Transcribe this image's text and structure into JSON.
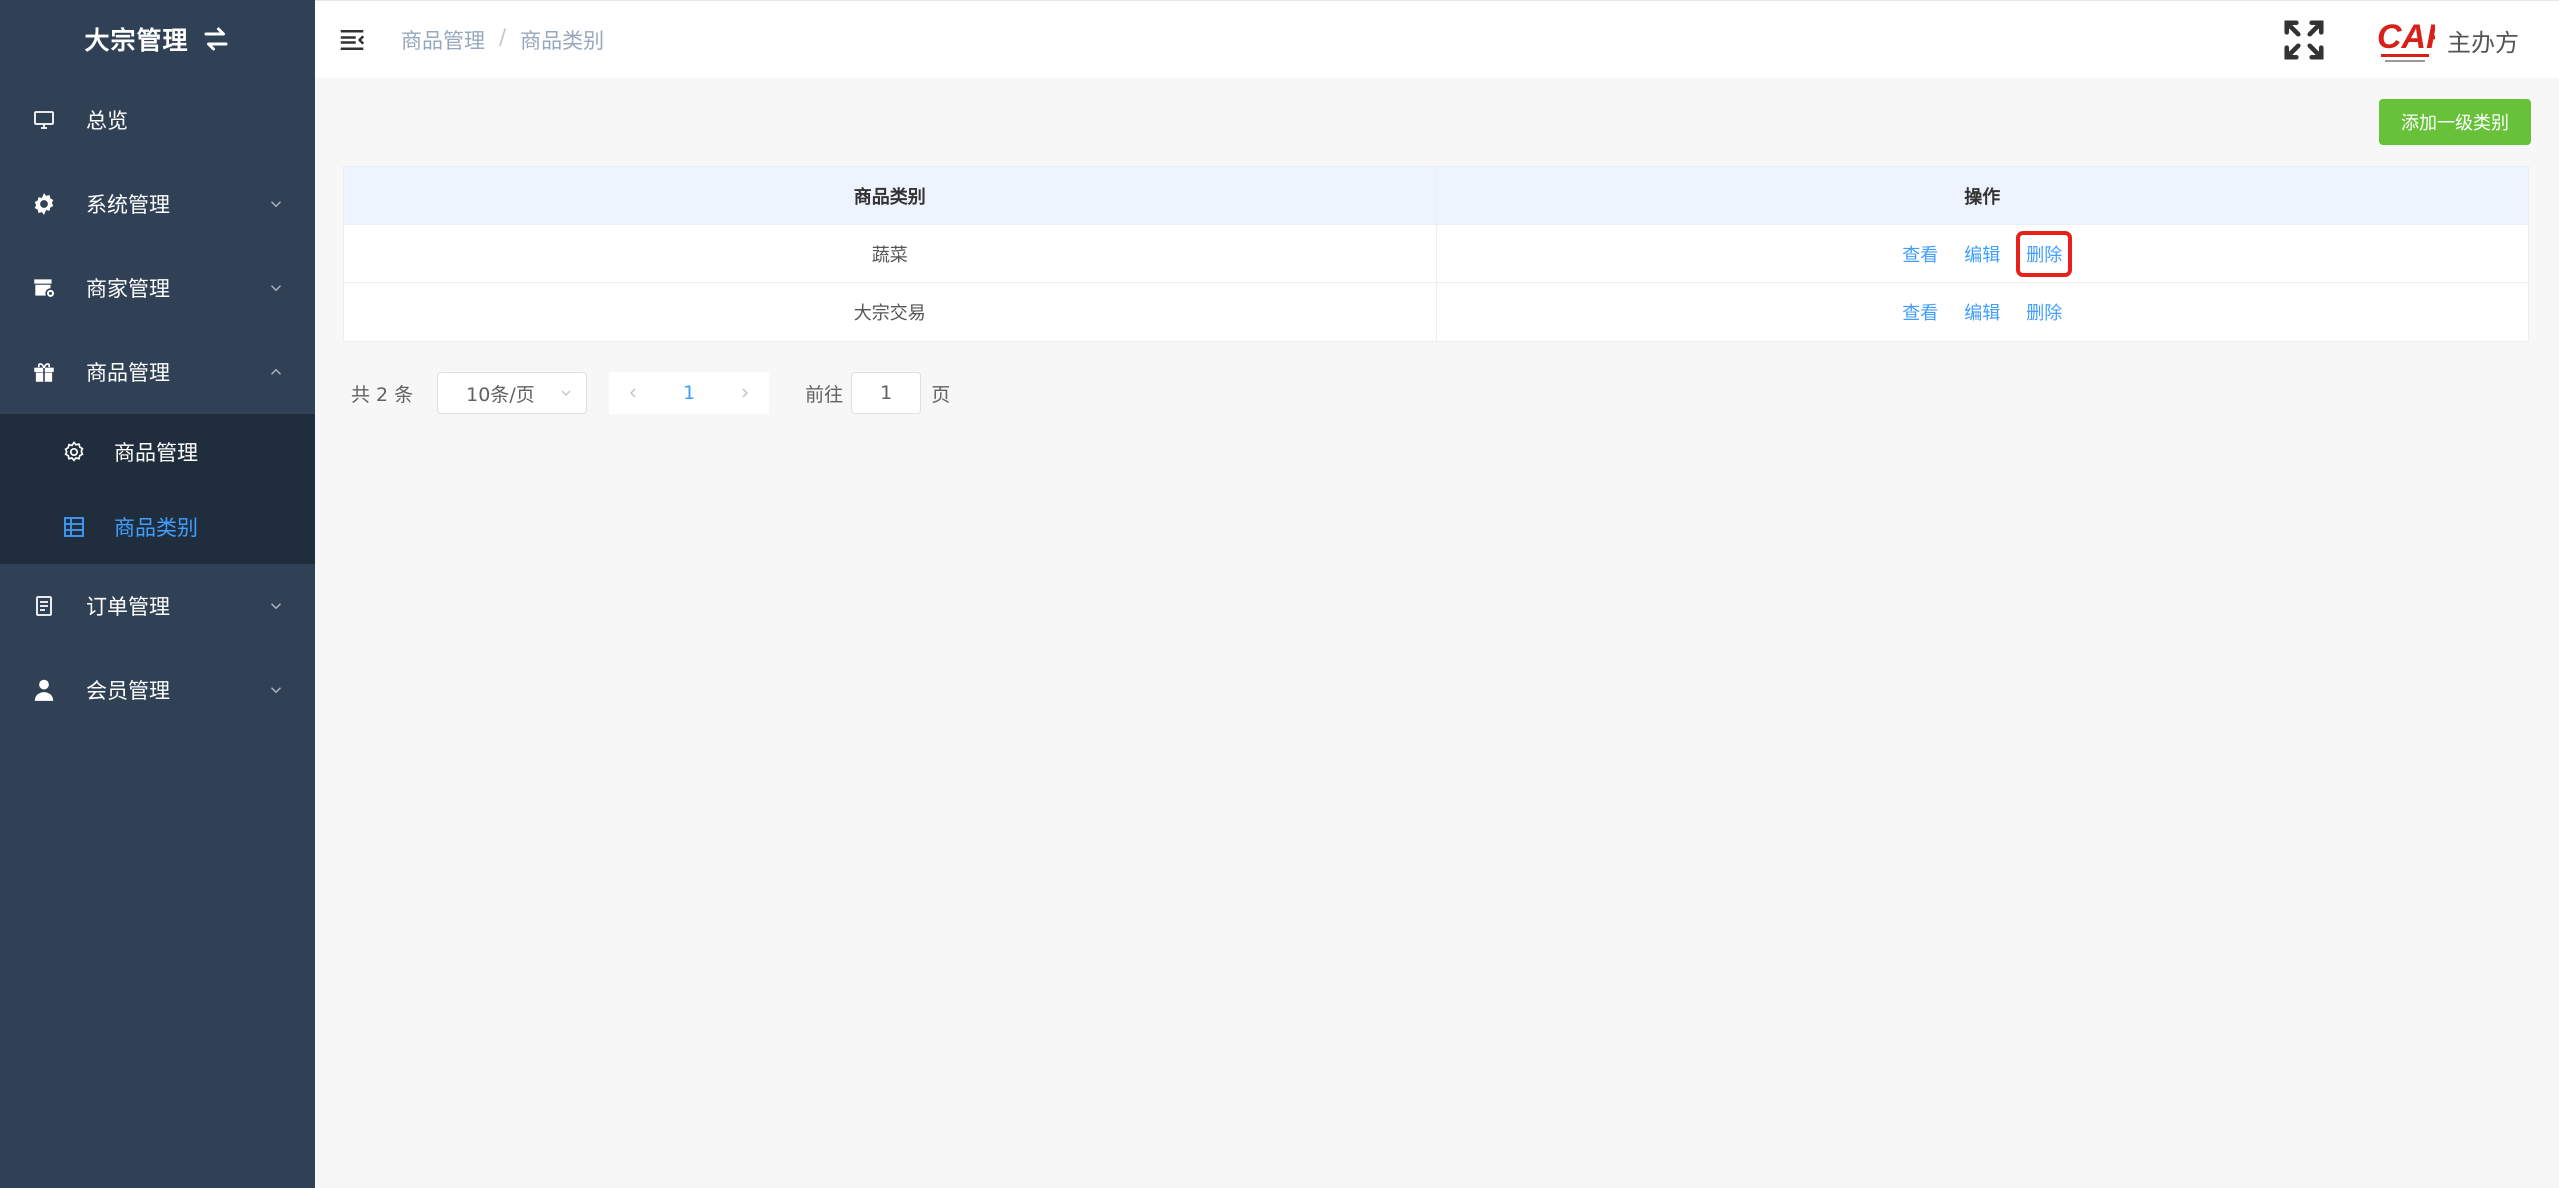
{
  "sidebar": {
    "brand": "大宗管理",
    "items": [
      {
        "label": "总览"
      },
      {
        "label": "系统管理"
      },
      {
        "label": "商家管理"
      },
      {
        "label": "商品管理"
      },
      {
        "label": "订单管理"
      },
      {
        "label": "会员管理"
      }
    ],
    "submenu": [
      {
        "label": "商品管理"
      },
      {
        "label": "商品类别"
      }
    ]
  },
  "header": {
    "breadcrumb": [
      "商品管理",
      "商品类别"
    ],
    "breadcrumb_sep": "/",
    "host_text": "主办方"
  },
  "toolbar": {
    "add_label": "添加一级类别"
  },
  "table": {
    "headers": [
      "商品类别",
      "操作"
    ],
    "rows": [
      {
        "name": "蔬菜",
        "actions": [
          "查看",
          "编辑",
          "删除"
        ]
      },
      {
        "name": "大宗交易",
        "actions": [
          "查看",
          "编辑",
          "删除"
        ]
      }
    ]
  },
  "pagination": {
    "total": "共 2 条",
    "page_size": "10条/页",
    "current_page": "1",
    "jump_prefix": "前往",
    "jump_value": "1",
    "jump_suffix": "页"
  },
  "colors": {
    "sidebar_bg": "#304156",
    "submenu_bg": "#1f2d3d",
    "active": "#409eff",
    "add_button": "#67c23a",
    "highlight": "#e8201a"
  }
}
